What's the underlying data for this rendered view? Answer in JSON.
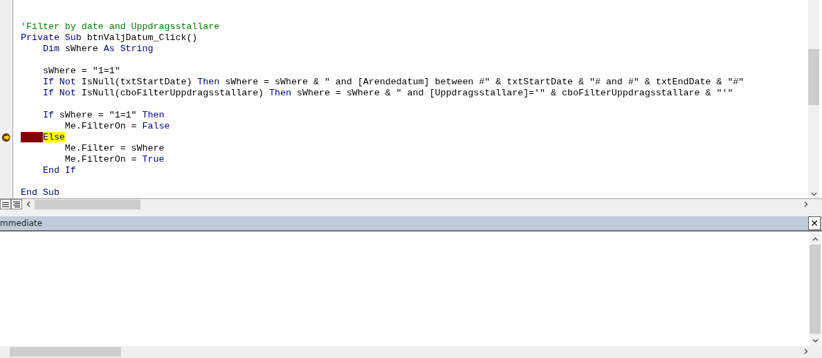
{
  "code_window": {
    "lines": [
      {
        "tokens": [
          {
            "text": "'Filter by date and Uppdragsstallare",
            "kind": "comment"
          }
        ]
      },
      {
        "tokens": [
          {
            "text": "Private Sub",
            "kind": "keyword"
          },
          {
            "text": " btnValjDatum_Click()",
            "kind": "plain"
          }
        ]
      },
      {
        "tokens": [
          {
            "text": "    Dim",
            "kind": "keyword"
          },
          {
            "text": " sWhere ",
            "kind": "plain"
          },
          {
            "text": "As String",
            "kind": "keyword"
          }
        ]
      },
      {
        "tokens": [
          {
            "text": "    sWhere = \"1=1\"",
            "kind": "plain"
          }
        ],
        "gap_before": true
      },
      {
        "tokens": [
          {
            "text": "    If Not",
            "kind": "keyword"
          },
          {
            "text": " IsNull(txtStartDate) ",
            "kind": "plain"
          },
          {
            "text": "Then",
            "kind": "keyword"
          },
          {
            "text": " sWhere = sWhere & \" and [Arendedatum] between #\" & txtStartDate & \"# and #\" & txtEndDate & \"#\"",
            "kind": "plain"
          }
        ]
      },
      {
        "tokens": [
          {
            "text": "    If Not",
            "kind": "keyword"
          },
          {
            "text": " IsNull(cboFilterUppdragsstallare) ",
            "kind": "plain"
          },
          {
            "text": "Then",
            "kind": "keyword"
          },
          {
            "text": " sWhere = sWhere & \" and [Uppdragsstallare]='\" & cboFilterUppdragsstallare & \"'\"",
            "kind": "plain"
          }
        ]
      },
      {
        "tokens": [
          {
            "text": "    If",
            "kind": "keyword"
          },
          {
            "text": " sWhere = \"1=1\" ",
            "kind": "plain"
          },
          {
            "text": "Then",
            "kind": "keyword"
          }
        ],
        "gap_before": true
      },
      {
        "tokens": [
          {
            "text": "        Me.FilterOn = ",
            "kind": "plain"
          },
          {
            "text": "False",
            "kind": "keyword"
          }
        ]
      },
      {
        "tokens": [
          {
            "text": "    Else",
            "kind": "keyword"
          }
        ],
        "breakpoint": true,
        "current": true
      },
      {
        "tokens": [
          {
            "text": "        Me.Filter = sWhere",
            "kind": "plain"
          }
        ]
      },
      {
        "tokens": [
          {
            "text": "        Me.FilterOn = ",
            "kind": "plain"
          },
          {
            "text": "True",
            "kind": "keyword"
          }
        ]
      },
      {
        "tokens": [
          {
            "text": "    End If",
            "kind": "keyword"
          }
        ]
      },
      {
        "tokens": [
          {
            "text": "End Sub",
            "kind": "keyword"
          }
        ],
        "gap_before": true
      }
    ]
  },
  "immediate_window": {
    "title": "mmediate",
    "close": "✕"
  }
}
